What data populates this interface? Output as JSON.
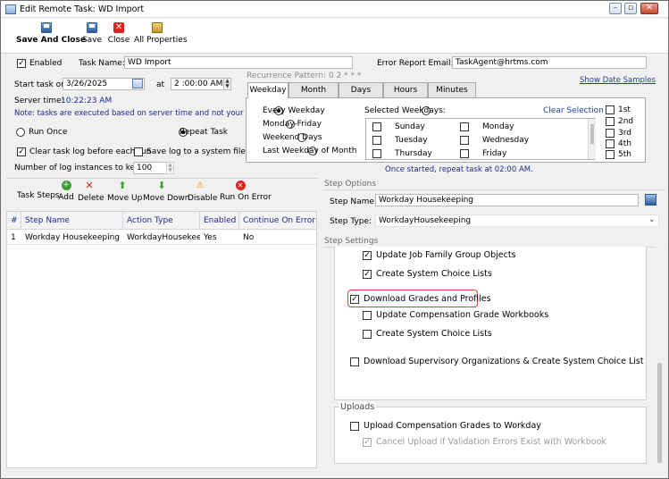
{
  "window": {
    "title": "Edit Remote Task: WD Import"
  },
  "toolbar": {
    "save_and_close": "Save And Close",
    "save": "Save",
    "close": "Close",
    "all_properties": "All Properties"
  },
  "task": {
    "enabled_label": "Enabled",
    "enabled": true,
    "name_label": "Task Name:",
    "name": "WD Import",
    "report_email_label": "Error Report Email:",
    "report_email": "TaskAgent@hrtms.com",
    "start_label": "Start task on",
    "start_date": "3/26/2025",
    "at_label": "at",
    "start_time": "2 :00:00 AM",
    "server_time_label": "Server time:",
    "server_time": "10:22:23 AM",
    "note": "Note: tasks are executed based on server time and not your local time!",
    "run_once": "Run Once",
    "repeat_task": "Repeat Task",
    "clear_log": "Clear task log before each run",
    "save_log": "Save log to a system file",
    "log_instances_label": "Number of log instances to keep:",
    "log_instances": "100"
  },
  "recurrence": {
    "pattern_label": "Recurrence Pattern: 0 2 * * *",
    "show_samples": "Show Date Samples",
    "tabs": [
      "Weekday",
      "Month",
      "Days",
      "Hours",
      "Minutes"
    ],
    "options": [
      "Every Weekday",
      "Monday-Friday",
      "Weekend Days",
      "Last Weekday of Month"
    ],
    "selected_weekdays": "Selected Weekdays:",
    "clear_selection": "Clear Selection",
    "days_col1": [
      "Sunday",
      "Tuesday",
      "Thursday"
    ],
    "days_col2": [
      "Monday",
      "Wednesday",
      "Friday"
    ],
    "ordinals": [
      "1st",
      "2nd",
      "3rd",
      "4th",
      "5th"
    ],
    "summary": "Once started, repeat task at 02:00 AM."
  },
  "steps": {
    "label": "Task Steps:",
    "actions": [
      "Add",
      "Delete",
      "Move Up",
      "Move Down",
      "Disable",
      "Run On Error"
    ],
    "columns": [
      "#",
      "Step Name",
      "Action Type",
      "Enabled",
      "Continue On Error"
    ],
    "rows": [
      {
        "num": "1",
        "name": "Workday Housekeeping",
        "type": "WorkdayHousekeeping",
        "enabled": "Yes",
        "continue": "No"
      }
    ]
  },
  "step_options": {
    "section": "Step Options",
    "name_label": "Step Name:",
    "name": "Workday Housekeeping",
    "type_label": "Step Type:",
    "type": "WorkdayHousekeeping"
  },
  "step_settings": {
    "section": "Step Settings",
    "items": [
      {
        "label": "Update Job Family Group Objects",
        "checked": true
      },
      {
        "label": "Create System Choice Lists",
        "checked": true
      },
      {
        "label": "Download Grades and Profiles",
        "checked": true
      },
      {
        "label": "Update Compensation Grade Workbooks",
        "checked": false
      },
      {
        "label": "Create System Choice Lists",
        "checked": false
      },
      {
        "label": "Download Supervisory Organizations & Create System Choice List",
        "checked": false
      }
    ]
  },
  "uploads": {
    "title": "Uploads",
    "upload_label": "Upload Compensation Grades to Workday",
    "cancel_label": "Cancel Upload if Validation Errors Exist with Workbook"
  }
}
